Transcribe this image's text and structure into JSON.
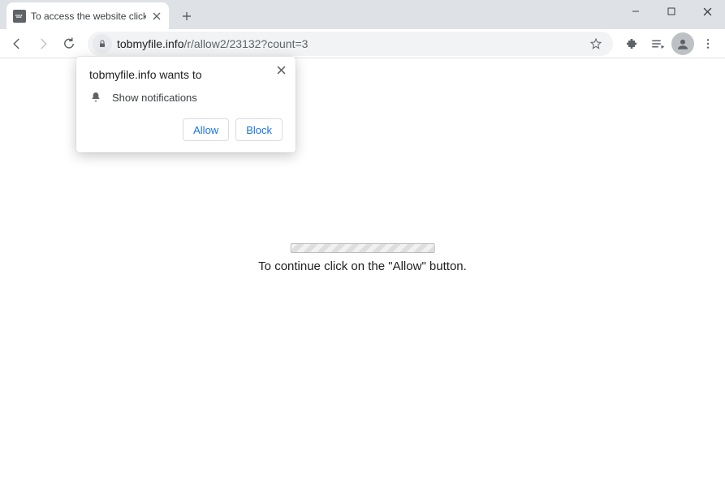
{
  "window": {
    "tab_title": "To access the website click the \"A",
    "controls": {
      "min": "min",
      "max": "max",
      "close": "close"
    }
  },
  "toolbar": {
    "back": "Back",
    "forward": "Forward",
    "reload": "Reload",
    "url_host": "tobmyfile.info",
    "url_path": "/r/allow2/23132?count=3",
    "star": "Bookmark",
    "extensions": "Extensions",
    "media": "Media",
    "profile": "Profile",
    "menu": "Menu"
  },
  "prompt": {
    "origin_text": "tobmyfile.info wants to",
    "permission_label": "Show notifications",
    "allow_label": "Allow",
    "block_label": "Block",
    "close": "Close"
  },
  "page": {
    "message": "To continue click on the \"Allow\" button."
  }
}
